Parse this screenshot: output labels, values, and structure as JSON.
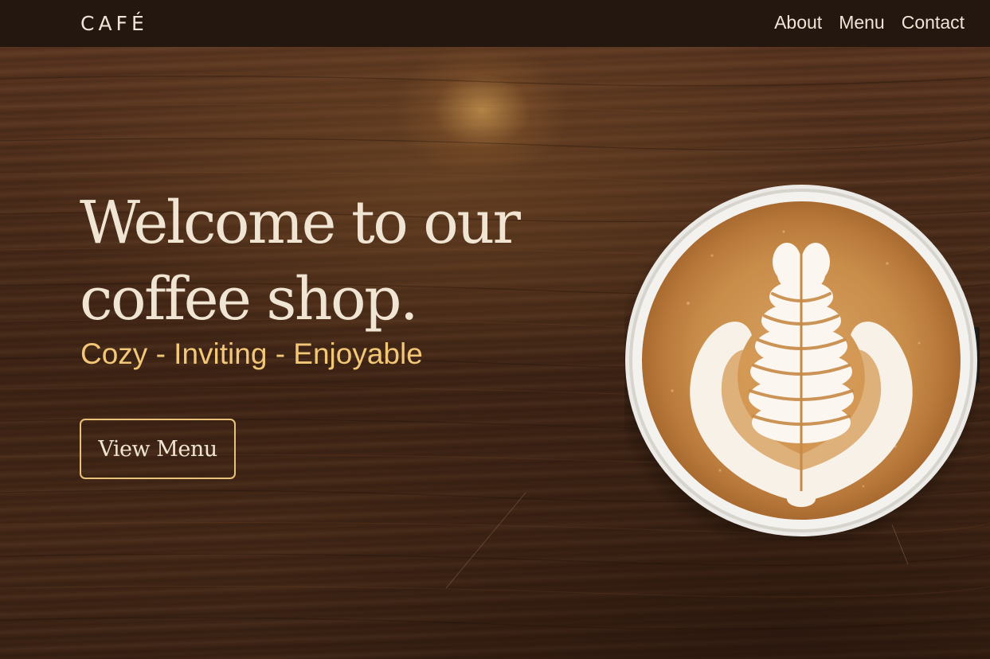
{
  "nav": {
    "logo": "CAFÉ",
    "links": [
      "About",
      "Menu",
      "Contact"
    ]
  },
  "hero": {
    "title_line1": "Welcome to our",
    "title_line2": "coffee shop.",
    "subtitle": "Cozy - Inviting - Enjoyable",
    "button_label": "View Menu",
    "image": "latte-art-coffee-cup-on-wood-table"
  },
  "colors": {
    "nav_bg": "#231710",
    "text_light": "#f0e4d2",
    "accent": "#f2c777",
    "button_border": "#e9c27a"
  }
}
